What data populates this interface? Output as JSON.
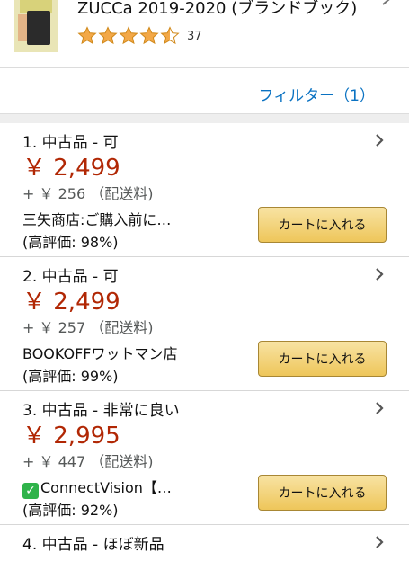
{
  "product": {
    "title": "ZUCCa 2019-2020 (ブランドブック)",
    "rating": 4.5,
    "rating_count": "37"
  },
  "filter": {
    "label": "フィルター（1）"
  },
  "offers": [
    {
      "condition": "1. 中古品 - 可",
      "price": "￥ 2,499",
      "shipping": "+ ￥ 256 （配送料)",
      "seller": "三矢商店:ご購入前に…",
      "seller_rating": "(高評価: 98%)",
      "cart_label": "カートに入れる"
    },
    {
      "condition": "2. 中古品 - 可",
      "price": "￥ 2,499",
      "shipping": "+ ￥ 257 （配送料)",
      "seller": "BOOKOFFワットマン店",
      "seller_rating": "(高評価: 99%)",
      "cart_label": "カートに入れる"
    },
    {
      "condition": "3. 中古品 - 非常に良い",
      "price": "￥ 2,995",
      "shipping": "+ ￥ 447 （配送料)",
      "seller": "ConnectVision【…",
      "seller_rating": "(高評価: 92%)",
      "cart_label": "カートに入れる"
    },
    {
      "condition": "4. 中古品 - ほぼ新品"
    }
  ],
  "colors": {
    "price": "#b12704",
    "link": "#0a72c2",
    "star": "#f3a847",
    "button": "#f0c14b"
  },
  "icons": {
    "chevron": "chevron-right-icon",
    "star": "star-icon",
    "check": "check-mark-icon"
  }
}
